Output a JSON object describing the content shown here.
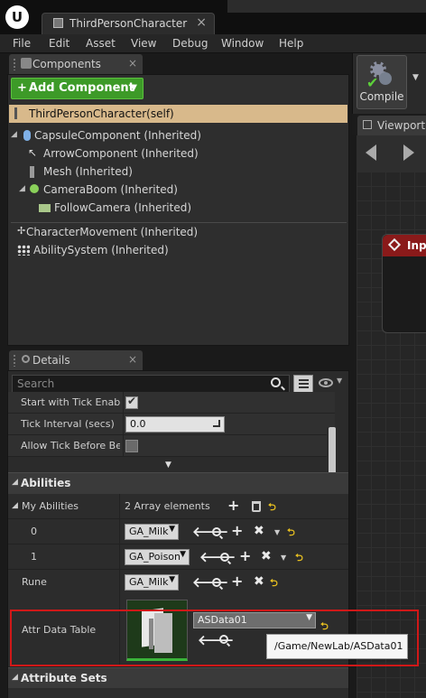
{
  "window": {
    "logo": "U",
    "tab_title": "ThirdPersonCharacter",
    "tab_close": "×"
  },
  "menu": [
    "File",
    "Edit",
    "Asset",
    "View",
    "Debug",
    "Window",
    "Help"
  ],
  "components_panel": {
    "tab_label": "Components",
    "close": "×",
    "add_button": "Add Component",
    "self_item": "ThirdPersonCharacter(self)",
    "items": [
      {
        "label": "CapsuleComponent (Inherited)",
        "icon": "capsule-icon"
      },
      {
        "label": "ArrowComponent (Inherited)",
        "icon": "arrow-component-icon"
      },
      {
        "label": "Mesh (Inherited)",
        "icon": "mesh-icon"
      },
      {
        "label": "CameraBoom (Inherited)",
        "icon": "spring-arm-icon"
      },
      {
        "label": "FollowCamera (Inherited)",
        "icon": "camera-icon"
      },
      {
        "label": "CharacterMovement (Inherited)",
        "icon": "movement-icon"
      },
      {
        "label": "AbilitySystem (Inherited)",
        "icon": "ability-system-icon"
      }
    ]
  },
  "toolbar": {
    "compile_label": "Compile"
  },
  "viewport": {
    "tab_label": "Viewport",
    "node_label": "Inpu"
  },
  "details_panel": {
    "tab_label": "Details",
    "close": "×",
    "search_placeholder": "Search",
    "properties": [
      {
        "label": "Start with Tick Enabled",
        "type": "checkbox",
        "checked": true
      },
      {
        "label": "Tick Interval (secs)",
        "type": "number",
        "value": "0.0"
      },
      {
        "label": "Allow Tick Before BeginPlay",
        "type": "checkbox",
        "checked": false
      }
    ],
    "abilities": {
      "header": "Abilities",
      "my_abilities_label": "My Abilities",
      "array_count": "2 Array elements",
      "elements": [
        {
          "index": "0",
          "value": "GA_Milk"
        },
        {
          "index": "1",
          "value": "GA_Poison"
        }
      ],
      "rune_label": "Rune",
      "rune_value": "GA_Milk",
      "attr_table_label": "Attr Data Table",
      "attr_table_value": "ASData01",
      "tooltip": "/Game/NewLab/ASData01"
    },
    "attribute_sets_header": "Attribute Sets"
  },
  "colors": {
    "add_button": "#3d9a28",
    "selected_row": "#d8b98b",
    "highlight": "#d01818",
    "node_header": "#8a1a1a"
  }
}
